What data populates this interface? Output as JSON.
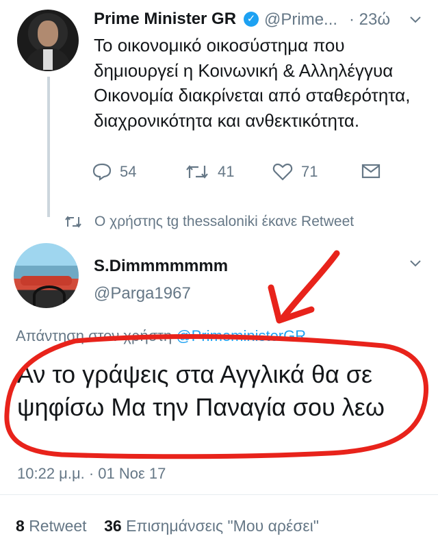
{
  "tweet1": {
    "name": "Prime Minister GR",
    "handle": "@Prime...",
    "time": "· 23ώ",
    "text": "Το οικονομικό οικοσύστημα που δημιουργεί η Κοινωνική & Αλληλέγγυα Οικονομία διακρίνεται από σταθερότητα, διαχρονικότητα και ανθεκτικότητα.",
    "replies": "54",
    "retweets": "41",
    "likes": "71"
  },
  "retweet_notice": "Ο χρήστης tg thessaloniki έκανε Retweet",
  "tweet2": {
    "name": "S.Dimmmmmmm",
    "handle": "@Parga1967",
    "reply_prefix": "Απάντηση στον χρήστη ",
    "reply_user": "@PrimeministerGR",
    "text": "Αν το γράψεις στα Αγγλικά θα σε ψηφίσω  Μα την Παναγία σου λεω",
    "timestamp": "10:22 μ.μ. · 01 Νοε 17",
    "retweet_count": "8",
    "retweet_label": "Retweet",
    "likes_count": "36",
    "likes_label": "Επισημάνσεις \"Μου αρέσει\""
  },
  "colors": {
    "accent": "#1da1f2",
    "secondary_text": "#657786",
    "annotation": "#e8231b"
  },
  "icons": [
    "verified-badge-icon",
    "chevron-down-icon",
    "reply-icon",
    "retweet-icon",
    "like-icon",
    "message-icon",
    "retweet-small-icon"
  ]
}
